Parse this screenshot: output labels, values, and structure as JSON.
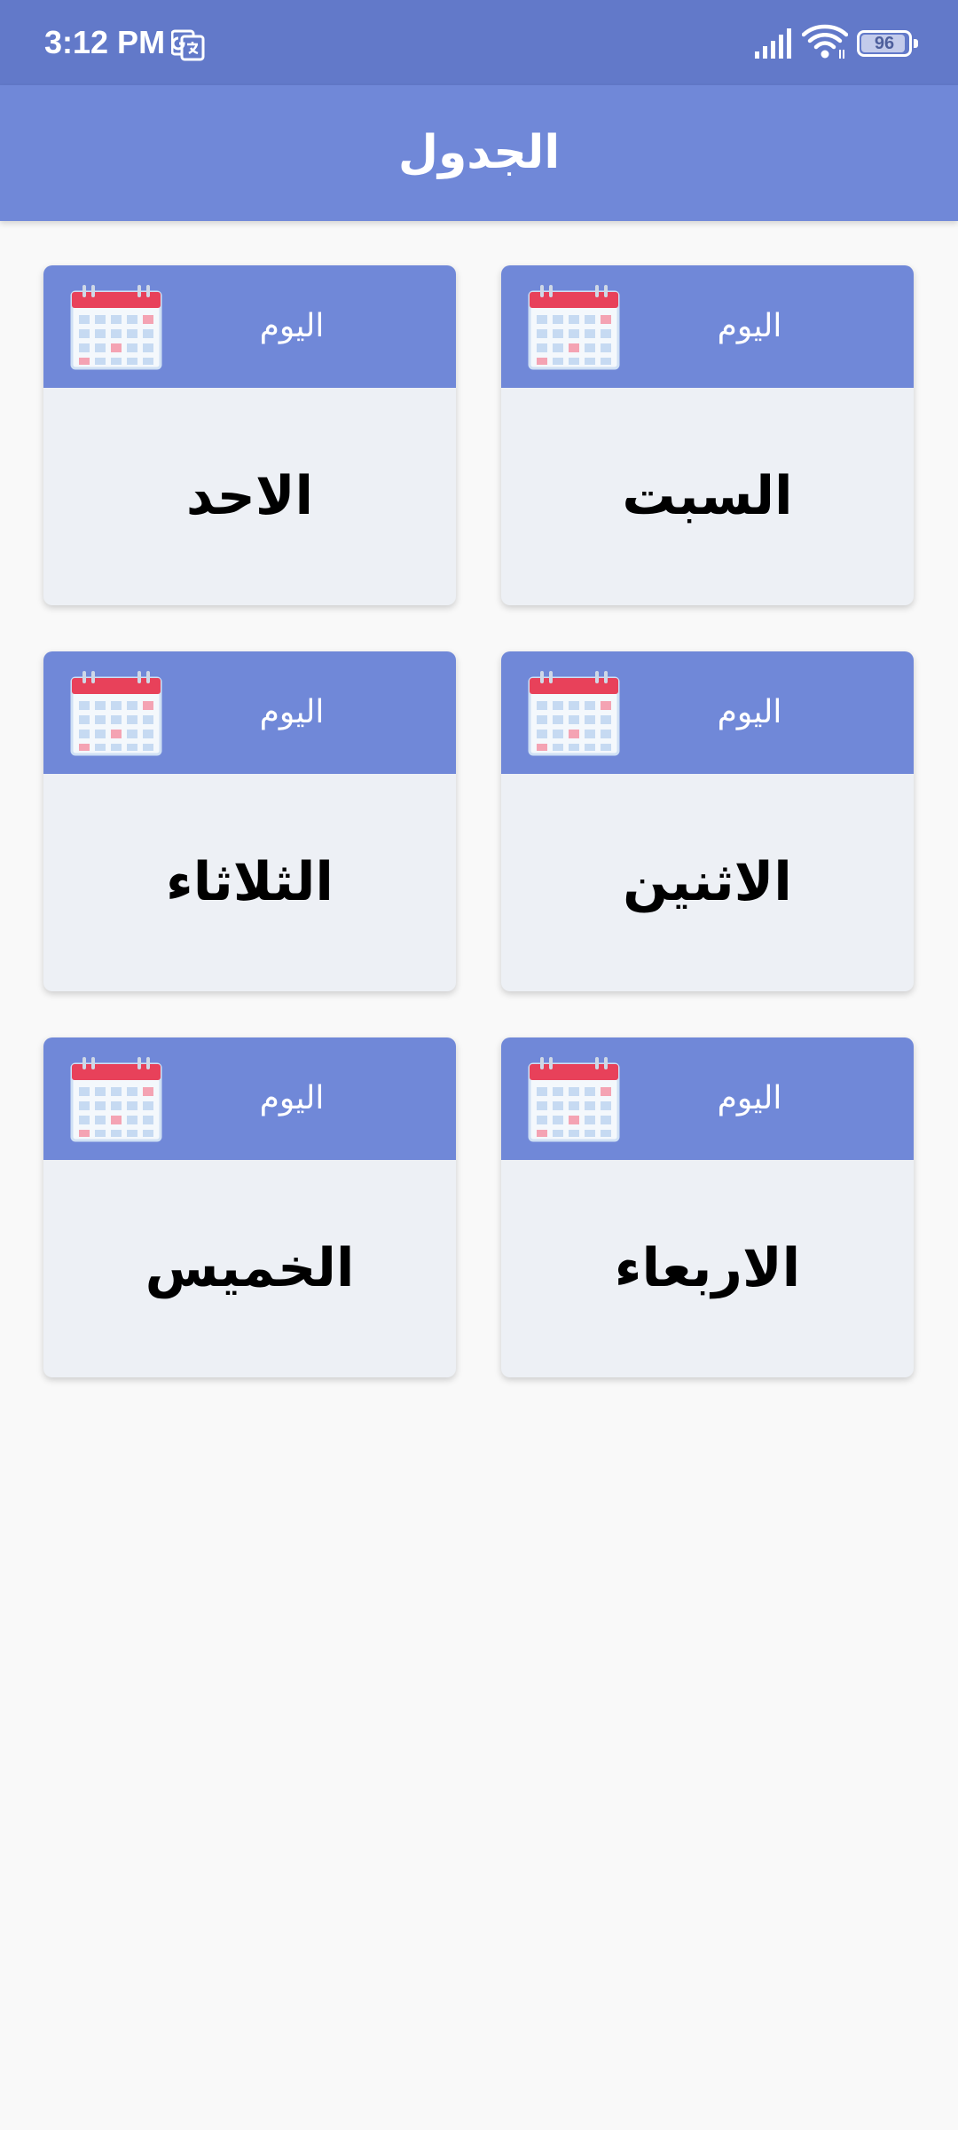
{
  "status_bar": {
    "time": "3:12 PM",
    "battery_level": "96"
  },
  "app_bar": {
    "title": "الجدول"
  },
  "cards": [
    {
      "caption": "اليوم",
      "day": "السبت"
    },
    {
      "caption": "اليوم",
      "day": "الاحد"
    },
    {
      "caption": "اليوم",
      "day": "الاثنين"
    },
    {
      "caption": "اليوم",
      "day": "الثلاثاء"
    },
    {
      "caption": "اليوم",
      "day": "الاربعاء"
    },
    {
      "caption": "اليوم",
      "day": "الخميس"
    }
  ],
  "icons": {
    "status": [
      "translate-icon",
      "signal-icon",
      "wifi-icon",
      "battery-icon"
    ],
    "card": "calendar-icon"
  },
  "colors": {
    "status_bar": "#6279c9",
    "accent": "#7088d8",
    "card_background": "#edf0f5",
    "page_background": "#f9f9f9",
    "calendar_red": "#e8415a"
  }
}
